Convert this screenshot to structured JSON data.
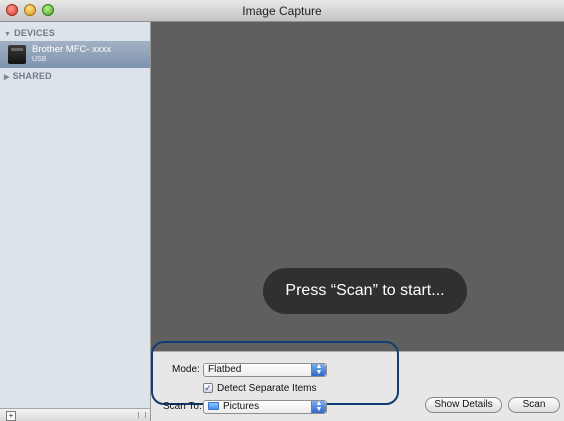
{
  "window": {
    "title": "Image Capture"
  },
  "sidebar": {
    "devices_header": "DEVICES",
    "shared_header": "SHARED",
    "device": {
      "name": "Brother MFC- xxxx",
      "connection": "USB"
    }
  },
  "preview": {
    "message": "Press “Scan” to start..."
  },
  "controls": {
    "mode_label": "Mode:",
    "mode_value": "Flatbed",
    "detect_label": "Detect Separate Items",
    "detect_checked": true,
    "scan_to_label": "Scan To:",
    "scan_to_value": "Pictures",
    "show_details_label": "Show Details",
    "scan_label": "Scan"
  },
  "icons": {
    "device": "scanner-icon",
    "folder": "folder-icon",
    "add": "plus-icon"
  },
  "colors": {
    "preview_bg": "#5f5f5f",
    "selection": "#8a9cb4",
    "highlight": "#123d73"
  }
}
